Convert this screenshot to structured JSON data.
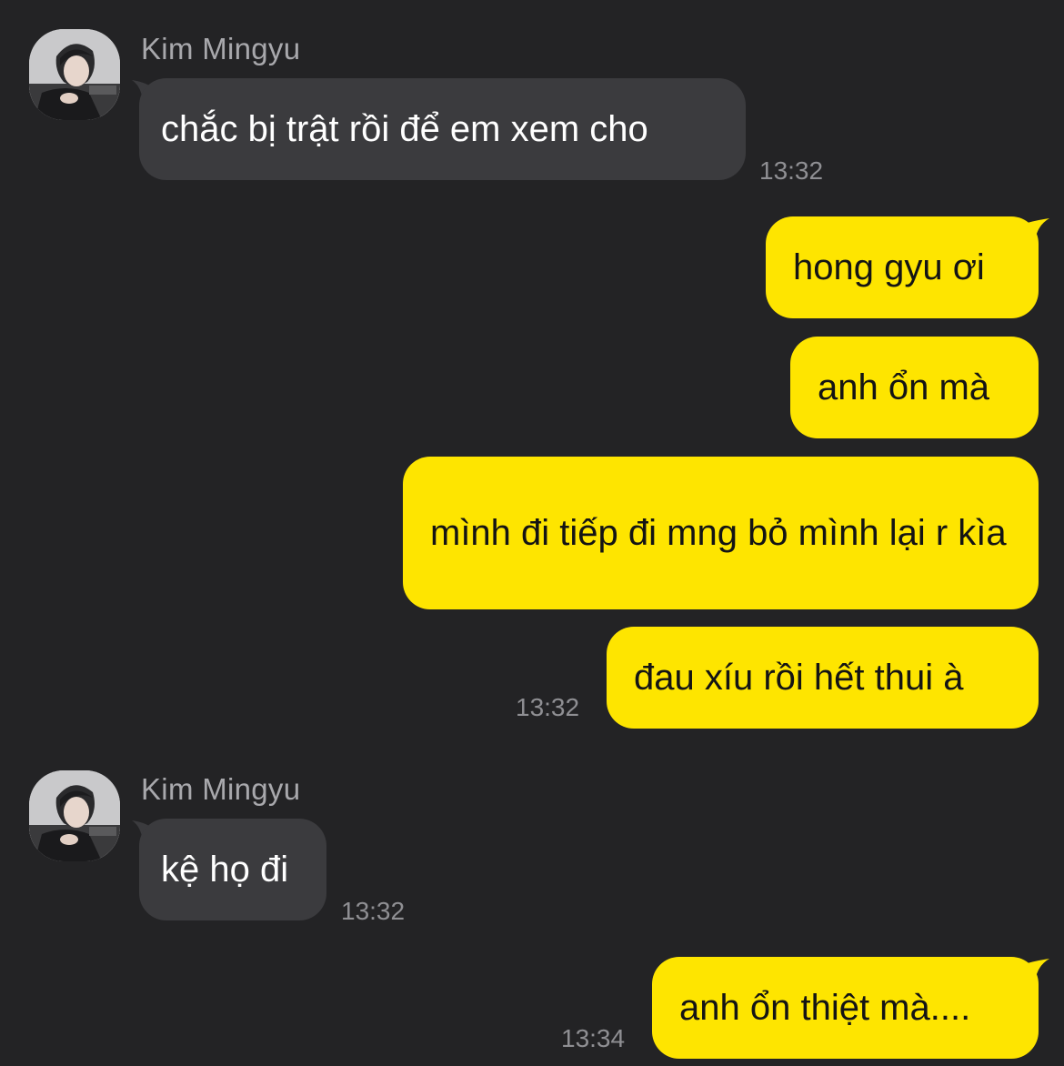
{
  "chat": {
    "messages": [
      {
        "side": "in",
        "sender": "Kim Mingyu",
        "text": "chắc bị trật rồi để em xem cho",
        "time": "13:32"
      },
      {
        "side": "out",
        "text": "hong gyu ơi"
      },
      {
        "side": "out",
        "text": "anh ổn mà"
      },
      {
        "side": "out",
        "text": "mình đi tiếp đi mng bỏ mình lại r kìa"
      },
      {
        "side": "out",
        "text": "đau xíu rồi hết thui à",
        "time": "13:32"
      },
      {
        "side": "in",
        "sender": "Kim Mingyu",
        "text": "kệ họ đi",
        "time": "13:32"
      },
      {
        "side": "out",
        "text": "anh ổn thiệt mà....",
        "time": "13:34"
      }
    ]
  },
  "colors": {
    "background": "#232325",
    "incoming_bubble": "#3b3b3e",
    "outgoing_bubble": "#fee500",
    "sender_name": "#a8a8ac",
    "timestamp": "#8f8f93"
  },
  "icons": {
    "avatar": "profile-photo"
  }
}
